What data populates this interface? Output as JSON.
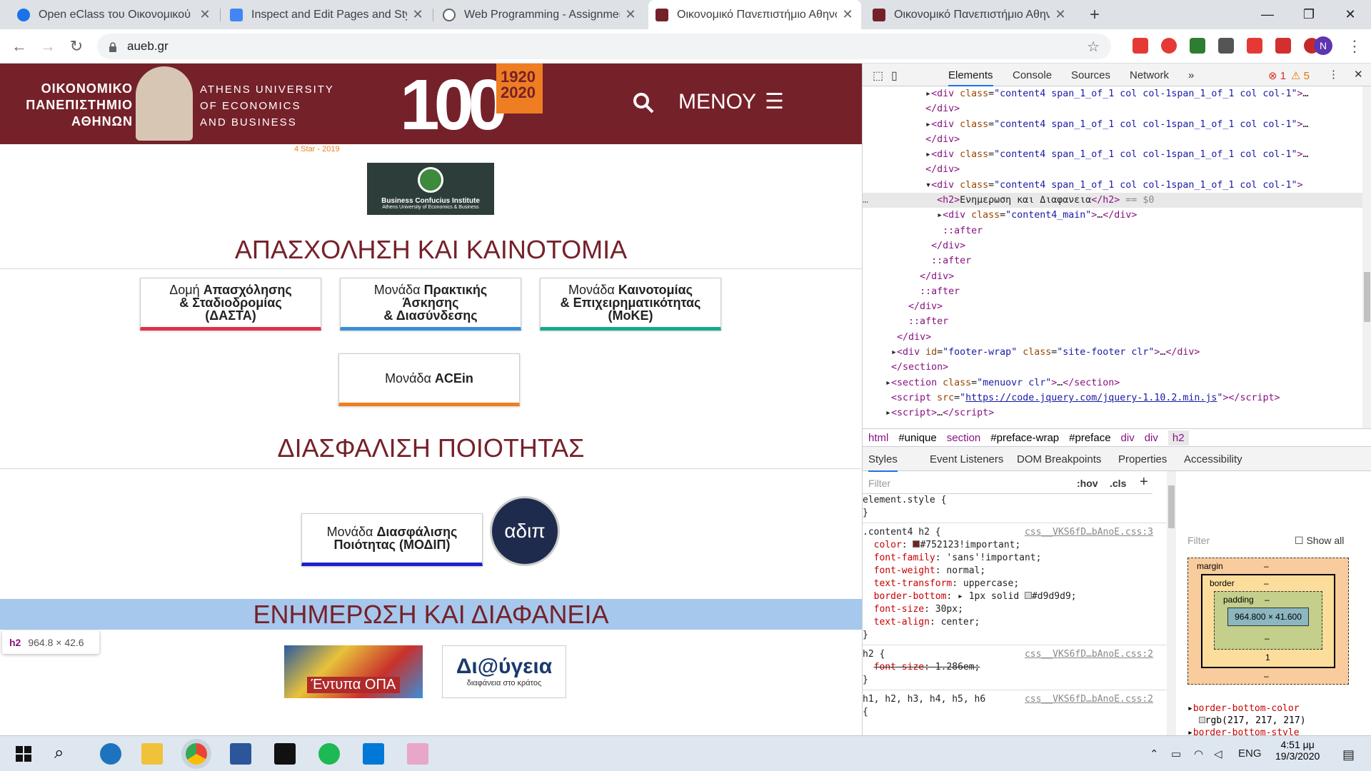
{
  "browser": {
    "tabs": [
      {
        "title": "Open eClass του Οικονομικού Πα",
        "active": false,
        "color": "#1a73e8"
      },
      {
        "title": "Inspect and Edit Pages and Styles",
        "active": false,
        "color": "#5f6368"
      },
      {
        "title": "Web Programming - Assignment",
        "active": false,
        "color": "#202124"
      },
      {
        "title": "Οικονομικό Πανεπιστήμιο Αθηνώ",
        "active": true,
        "color": "#75212a"
      },
      {
        "title": "Οικονομικό Πανεπιστήμιο Αθηνώ",
        "active": false,
        "color": "#75212a"
      }
    ],
    "url": "aueb.gr",
    "profile_initial": "N"
  },
  "site": {
    "logo_gr": [
      "ΟΙΚΟΝΟΜΙΚΟ",
      "ΠΑΝΕΠΙΣΤΗΜΙΟ",
      "ΑΘΗΝΩΝ"
    ],
    "logo_en": [
      "ATHENS UNIVERSITY",
      "OF ECONOMICS",
      "AND BUSINESS"
    ],
    "anniversary": "100",
    "anniversary_years": "1920 2020",
    "menu_label": "ΜΕΝΟΥ",
    "star_rating": "4 Star - 2019",
    "confucius": "Business Confucius Institute",
    "confucius_sub": "Athens University of Economics & Business",
    "sections": [
      {
        "title": "ΑΠΑΣΧΟΛΗΣΗ ΚΑΙ ΚΑΙΝΟΤΟΜΙΑ"
      },
      {
        "title": "ΔΙΑΣΦΑΛΙΣΗ ΠΟΙΟΤΗΤΑΣ"
      },
      {
        "title": "ΕΝΗΜΕΡΩΣΗ ΚΑΙ ΔΙΑΦΑΝΕΙΑ"
      }
    ],
    "units": [
      {
        "l1": "Δομή",
        "b1": "Απασχόλησης",
        "l2": "& Σταδιοδρομίας",
        "l3": "(ΔΑΣΤΑ)",
        "bar": "#e0304b"
      },
      {
        "l1": "Μονάδα",
        "b1": "Πρακτικής",
        "l2": "Άσκησης",
        "l3": "& Διασύνδεσης",
        "bar": "#3a8fd8"
      },
      {
        "l1": "Μονάδα",
        "b1": "Καινοτομίας",
        "l2": "& Επιχειρηματικότητας",
        "l3": "(ΜοΚΕ)",
        "bar": "#18a98d"
      }
    ],
    "acein": {
      "prefix": "Μονάδα",
      "bold": "ACEin",
      "bar": "#ef7d22"
    },
    "modip": {
      "l1": "Μονάδα",
      "b1": "Διασφάλισης",
      "l2": "Ποιότητας (ΜΟΔΙΠ)",
      "bar": "#1a22c8"
    },
    "adip": "αδιπ",
    "opa": "Έντυπα ΟΠΑ",
    "diavgeia": "Δι@ύγεια",
    "diavgeia_sub": "διαφάνεια στο κράτος",
    "tooltip": {
      "tag": "h2",
      "size": "964.8 × 42.6"
    }
  },
  "devtools": {
    "tabs": [
      "Elements",
      "Console",
      "Sources",
      "Network"
    ],
    "errors": "1",
    "warnings": "5",
    "breadcrumbs": [
      "html",
      "#unique",
      "section",
      "#preface-wrap",
      "#preface",
      "div",
      "div",
      "h2"
    ],
    "subtabs": [
      "Styles",
      "Event Listeners",
      "DOM Breakpoints",
      "Properties",
      "Accessibility"
    ],
    "filter": "Filter",
    "hov": ":hov",
    "cls": ".cls",
    "box": {
      "margin": "margin",
      "border": "border",
      "padding": "padding",
      "content": "964.800 × 41.600",
      "dash": "–",
      "one": "1"
    },
    "computed_filter": "Filter",
    "show_all": "Show all"
  },
  "taskbar": {
    "lang": "ENG",
    "time": "4:51 μμ",
    "date": "19/3/2020"
  }
}
